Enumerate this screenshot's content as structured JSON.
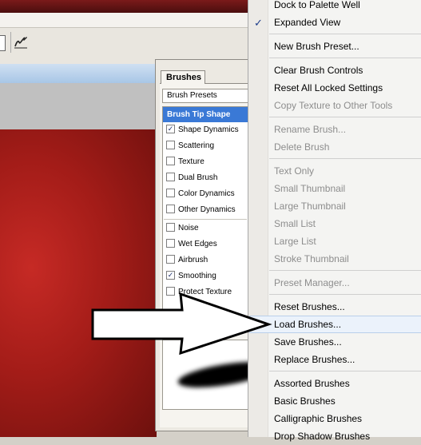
{
  "panel": {
    "tab_label": "Brushes",
    "presets_label": "Brush Presets",
    "tip_shape_label": "Brush Tip Shape",
    "options": [
      {
        "label": "Shape Dynamics",
        "checked": true
      },
      {
        "label": "Scattering",
        "checked": false
      },
      {
        "label": "Texture",
        "checked": false
      },
      {
        "label": "Dual Brush",
        "checked": false
      },
      {
        "label": "Color Dynamics",
        "checked": false
      },
      {
        "label": "Other Dynamics",
        "checked": false
      },
      {
        "label": "Noise",
        "checked": false
      },
      {
        "label": "Wet Edges",
        "checked": false
      },
      {
        "label": "Airbrush",
        "checked": false
      },
      {
        "label": "Smoothing",
        "checked": true
      },
      {
        "label": "Protect Texture",
        "checked": false
      }
    ]
  },
  "menu": {
    "items": [
      {
        "label": "Dock to Palette Well",
        "enabled": true
      },
      {
        "label": "Expanded View",
        "enabled": true,
        "checked": true
      },
      {
        "label": "New Brush Preset...",
        "enabled": true
      },
      {
        "label": "Clear Brush Controls",
        "enabled": true
      },
      {
        "label": "Reset All Locked Settings",
        "enabled": true
      },
      {
        "label": "Copy Texture to Other Tools",
        "enabled": false
      },
      {
        "label": "Rename Brush...",
        "enabled": false
      },
      {
        "label": "Delete Brush",
        "enabled": false
      },
      {
        "label": "Text Only",
        "enabled": false
      },
      {
        "label": "Small Thumbnail",
        "enabled": false
      },
      {
        "label": "Large Thumbnail",
        "enabled": false
      },
      {
        "label": "Small List",
        "enabled": false
      },
      {
        "label": "Large List",
        "enabled": false
      },
      {
        "label": "Stroke Thumbnail",
        "enabled": false
      },
      {
        "label": "Preset Manager...",
        "enabled": false
      },
      {
        "label": "Reset Brushes...",
        "enabled": true
      },
      {
        "label": "Load Brushes...",
        "enabled": true,
        "highlighted": true
      },
      {
        "label": "Save Brushes...",
        "enabled": true
      },
      {
        "label": "Replace Brushes...",
        "enabled": true
      },
      {
        "label": "Assorted Brushes",
        "enabled": true
      },
      {
        "label": "Basic Brushes",
        "enabled": true
      },
      {
        "label": "Calligraphic Brushes",
        "enabled": true
      },
      {
        "label": "Drop Shadow Brushes",
        "enabled": true
      }
    ]
  },
  "colors": {
    "selection_blue": "#3a79d6",
    "canvas_red": "#a31c18",
    "menu_highlight": "#ebf2fb"
  },
  "icons": {
    "toolbar_tool": "pen-icon",
    "menu_check": "checkmark-icon"
  }
}
